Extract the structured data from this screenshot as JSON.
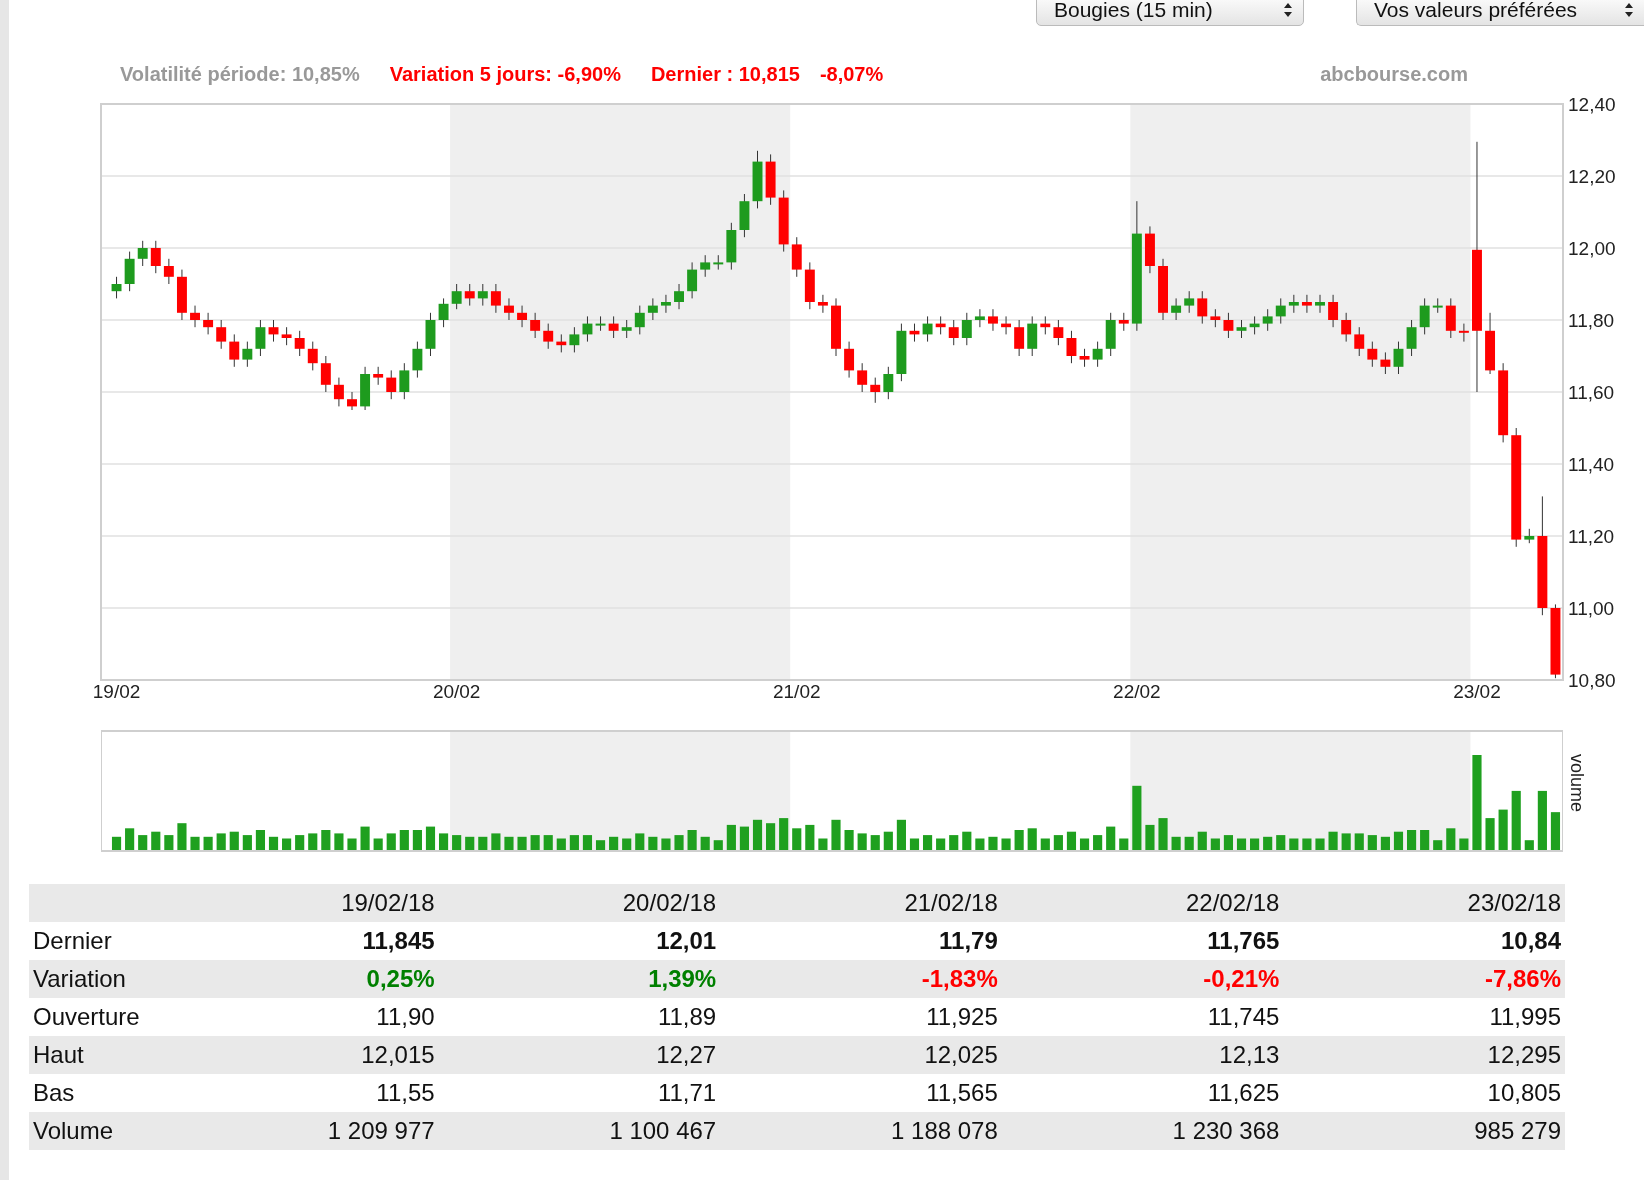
{
  "controls": [
    {
      "value": "Bougies (15 min)"
    },
    {
      "value": "Vos valeurs préférées"
    }
  ],
  "stats": [
    {
      "text": "Volatilité période: 10,85%",
      "color": "#999999"
    },
    {
      "text": "Variation 5 jours: -6,90%",
      "color": "#ff0000"
    },
    {
      "text": "Dernier : 10,815",
      "color": "#ff0000"
    },
    {
      "text": "-8,07%",
      "color": "#ff0000"
    }
  ],
  "source": "abcbourse.com",
  "chart": {
    "chart_data": {
      "type": "candlestick",
      "grid": true,
      "ylim": [
        10.8,
        12.4
      ],
      "yticks": [
        {
          "value": 12.4,
          "label": "12,40"
        },
        {
          "value": 12.2,
          "label": "12,20"
        },
        {
          "value": 12.0,
          "label": "12,00"
        },
        {
          "value": 11.8,
          "label": "11,80"
        },
        {
          "value": 11.6,
          "label": "11,60"
        },
        {
          "value": 11.4,
          "label": "11,40"
        },
        {
          "value": 11.2,
          "label": "11,20"
        },
        {
          "value": 11.0,
          "label": "11,00"
        },
        {
          "value": 10.8,
          "label": "10,80"
        }
      ],
      "categories": [
        "19/02",
        null,
        null,
        null,
        null,
        null,
        null,
        null,
        null,
        null,
        null,
        null,
        null,
        null,
        null,
        null,
        null,
        null,
        null,
        null,
        null,
        null,
        null,
        null,
        null,
        null,
        "20/02",
        null,
        null,
        null,
        null,
        null,
        null,
        null,
        null,
        null,
        null,
        null,
        null,
        null,
        null,
        null,
        null,
        null,
        null,
        null,
        null,
        null,
        null,
        null,
        null,
        null,
        "21/02",
        null,
        null,
        null,
        null,
        null,
        null,
        null,
        null,
        null,
        null,
        null,
        null,
        null,
        null,
        null,
        null,
        null,
        null,
        null,
        null,
        null,
        null,
        null,
        null,
        null,
        "22/02",
        null,
        null,
        null,
        null,
        null,
        null,
        null,
        null,
        null,
        null,
        null,
        null,
        null,
        null,
        null,
        null,
        null,
        null,
        null,
        null,
        null,
        null,
        null,
        null,
        null,
        "23/02",
        null,
        null,
        null,
        null,
        null,
        null
      ],
      "ohlc": [
        [
          11.88,
          11.92,
          11.86,
          11.9
        ],
        [
          11.9,
          11.99,
          11.88,
          11.97
        ],
        [
          11.97,
          12.02,
          11.95,
          12.0
        ],
        [
          12.0,
          12.02,
          11.93,
          11.95
        ],
        [
          11.95,
          11.97,
          11.9,
          11.92
        ],
        [
          11.92,
          11.94,
          11.8,
          11.82
        ],
        [
          11.82,
          11.84,
          11.78,
          11.8
        ],
        [
          11.8,
          11.82,
          11.76,
          11.78
        ],
        [
          11.78,
          11.8,
          11.72,
          11.74
        ],
        [
          11.74,
          11.76,
          11.67,
          11.69
        ],
        [
          11.69,
          11.74,
          11.67,
          11.72
        ],
        [
          11.72,
          11.8,
          11.7,
          11.78
        ],
        [
          11.78,
          11.8,
          11.74,
          11.76
        ],
        [
          11.76,
          11.78,
          11.73,
          11.75
        ],
        [
          11.75,
          11.77,
          11.7,
          11.72
        ],
        [
          11.72,
          11.74,
          11.66,
          11.68
        ],
        [
          11.68,
          11.7,
          11.6,
          11.62
        ],
        [
          11.62,
          11.64,
          11.56,
          11.58
        ],
        [
          11.58,
          11.6,
          11.55,
          11.56
        ],
        [
          11.56,
          11.67,
          11.55,
          11.65
        ],
        [
          11.65,
          11.67,
          11.62,
          11.64
        ],
        [
          11.64,
          11.66,
          11.58,
          11.6
        ],
        [
          11.6,
          11.68,
          11.58,
          11.66
        ],
        [
          11.66,
          11.74,
          11.64,
          11.72
        ],
        [
          11.72,
          11.82,
          11.7,
          11.8
        ],
        [
          11.8,
          11.86,
          11.78,
          11.845
        ],
        [
          11.845,
          11.9,
          11.83,
          11.88
        ],
        [
          11.88,
          11.9,
          11.84,
          11.86
        ],
        [
          11.86,
          11.9,
          11.84,
          11.88
        ],
        [
          11.88,
          11.9,
          11.82,
          11.84
        ],
        [
          11.84,
          11.86,
          11.8,
          11.82
        ],
        [
          11.82,
          11.84,
          11.78,
          11.8
        ],
        [
          11.8,
          11.82,
          11.75,
          11.77
        ],
        [
          11.77,
          11.79,
          11.72,
          11.74
        ],
        [
          11.74,
          11.76,
          11.71,
          11.73
        ],
        [
          11.73,
          11.78,
          11.71,
          11.76
        ],
        [
          11.76,
          11.81,
          11.74,
          11.79
        ],
        [
          11.79,
          11.81,
          11.77,
          11.79
        ],
        [
          11.79,
          11.81,
          11.75,
          11.77
        ],
        [
          11.77,
          11.8,
          11.75,
          11.78
        ],
        [
          11.78,
          11.84,
          11.76,
          11.82
        ],
        [
          11.82,
          11.86,
          11.8,
          11.84
        ],
        [
          11.84,
          11.87,
          11.82,
          11.85
        ],
        [
          11.85,
          11.9,
          11.83,
          11.88
        ],
        [
          11.88,
          11.96,
          11.86,
          11.94
        ],
        [
          11.94,
          11.98,
          11.92,
          11.96
        ],
        [
          11.96,
          11.98,
          11.94,
          11.96
        ],
        [
          11.96,
          12.07,
          11.94,
          12.05
        ],
        [
          12.05,
          12.15,
          12.03,
          12.13
        ],
        [
          12.13,
          12.27,
          12.11,
          12.24
        ],
        [
          12.24,
          12.26,
          12.12,
          12.14
        ],
        [
          12.14,
          12.16,
          11.99,
          12.01
        ],
        [
          12.01,
          12.03,
          11.92,
          11.94
        ],
        [
          11.94,
          11.96,
          11.83,
          11.85
        ],
        [
          11.85,
          11.87,
          11.82,
          11.84
        ],
        [
          11.84,
          11.86,
          11.7,
          11.72
        ],
        [
          11.72,
          11.74,
          11.64,
          11.66
        ],
        [
          11.66,
          11.68,
          11.6,
          11.62
        ],
        [
          11.62,
          11.64,
          11.57,
          11.6
        ],
        [
          11.6,
          11.67,
          11.58,
          11.65
        ],
        [
          11.65,
          11.79,
          11.63,
          11.77
        ],
        [
          11.77,
          11.79,
          11.74,
          11.76
        ],
        [
          11.76,
          11.81,
          11.74,
          11.79
        ],
        [
          11.79,
          11.81,
          11.76,
          11.78
        ],
        [
          11.78,
          11.8,
          11.73,
          11.75
        ],
        [
          11.75,
          11.82,
          11.73,
          11.8
        ],
        [
          11.8,
          11.83,
          11.78,
          11.81
        ],
        [
          11.81,
          11.83,
          11.77,
          11.79
        ],
        [
          11.79,
          11.81,
          11.76,
          11.78
        ],
        [
          11.78,
          11.8,
          11.7,
          11.72
        ],
        [
          11.72,
          11.81,
          11.7,
          11.79
        ],
        [
          11.79,
          11.81,
          11.76,
          11.78
        ],
        [
          11.78,
          11.8,
          11.73,
          11.75
        ],
        [
          11.75,
          11.77,
          11.68,
          11.7
        ],
        [
          11.7,
          11.72,
          11.67,
          11.69
        ],
        [
          11.69,
          11.74,
          11.67,
          11.72
        ],
        [
          11.72,
          11.82,
          11.7,
          11.8
        ],
        [
          11.8,
          11.82,
          11.77,
          11.79
        ],
        [
          11.79,
          12.13,
          11.77,
          12.04
        ],
        [
          12.04,
          12.06,
          11.93,
          11.95
        ],
        [
          11.95,
          11.97,
          11.8,
          11.82
        ],
        [
          11.82,
          11.86,
          11.8,
          11.84
        ],
        [
          11.84,
          11.88,
          11.82,
          11.86
        ],
        [
          11.86,
          11.88,
          11.79,
          11.81
        ],
        [
          11.81,
          11.83,
          11.78,
          11.8
        ],
        [
          11.8,
          11.82,
          11.75,
          11.77
        ],
        [
          11.77,
          11.8,
          11.75,
          11.78
        ],
        [
          11.78,
          11.81,
          11.76,
          11.79
        ],
        [
          11.79,
          11.83,
          11.77,
          11.81
        ],
        [
          11.81,
          11.86,
          11.79,
          11.84
        ],
        [
          11.84,
          11.87,
          11.82,
          11.85
        ],
        [
          11.85,
          11.87,
          11.82,
          11.84
        ],
        [
          11.84,
          11.87,
          11.82,
          11.85
        ],
        [
          11.85,
          11.87,
          11.78,
          11.8
        ],
        [
          11.8,
          11.82,
          11.74,
          11.76
        ],
        [
          11.76,
          11.78,
          11.7,
          11.72
        ],
        [
          11.72,
          11.74,
          11.67,
          11.69
        ],
        [
          11.69,
          11.71,
          11.65,
          11.67
        ],
        [
          11.67,
          11.74,
          11.65,
          11.72
        ],
        [
          11.72,
          11.8,
          11.7,
          11.78
        ],
        [
          11.78,
          11.86,
          11.76,
          11.84
        ],
        [
          11.84,
          11.86,
          11.82,
          11.84
        ],
        [
          11.84,
          11.86,
          11.75,
          11.77
        ],
        [
          11.77,
          11.79,
          11.74,
          11.765
        ],
        [
          11.995,
          12.295,
          11.6,
          11.77
        ],
        [
          11.77,
          11.82,
          11.65,
          11.66
        ],
        [
          11.66,
          11.68,
          11.46,
          11.48
        ],
        [
          11.48,
          11.5,
          11.17,
          11.19
        ],
        [
          11.19,
          11.22,
          11.18,
          11.2
        ],
        [
          11.2,
          11.31,
          10.98,
          11.0
        ],
        [
          11.0,
          11.01,
          10.805,
          10.815
        ]
      ]
    }
  },
  "volume_label": "volume",
  "table": {
    "columns": [
      "19/02/18",
      "20/02/18",
      "21/02/18",
      "22/02/18",
      "23/02/18"
    ],
    "rows": [
      {
        "label": "Dernier",
        "bold": true,
        "cells": [
          {
            "value": "11,845"
          },
          {
            "value": "12,01"
          },
          {
            "value": "11,79"
          },
          {
            "value": "11,765"
          },
          {
            "value": "10,84"
          }
        ]
      },
      {
        "label": "Variation",
        "bold": true,
        "cells": [
          {
            "value": "0,25%",
            "color": "#008000"
          },
          {
            "value": "1,39%",
            "color": "#008000"
          },
          {
            "value": "-1,83%",
            "color": "#ff0000"
          },
          {
            "value": "-0,21%",
            "color": "#ff0000"
          },
          {
            "value": "-7,86%",
            "color": "#ff0000"
          }
        ]
      },
      {
        "label": "Ouverture",
        "bold": false,
        "cells": [
          {
            "value": "11,90"
          },
          {
            "value": "11,89"
          },
          {
            "value": "11,925"
          },
          {
            "value": "11,745"
          },
          {
            "value": "11,995"
          }
        ]
      },
      {
        "label": "Haut",
        "bold": false,
        "cells": [
          {
            "value": "12,015"
          },
          {
            "value": "12,27"
          },
          {
            "value": "12,025"
          },
          {
            "value": "12,13"
          },
          {
            "value": "12,295"
          }
        ]
      },
      {
        "label": "Bas",
        "bold": false,
        "cells": [
          {
            "value": "11,55"
          },
          {
            "value": "11,71"
          },
          {
            "value": "11,565"
          },
          {
            "value": "11,625"
          },
          {
            "value": "10,805"
          }
        ]
      },
      {
        "label": "Volume",
        "bold": false,
        "cells": [
          {
            "value": "1 209 977"
          },
          {
            "value": "1 100 467"
          },
          {
            "value": "1 188 078"
          },
          {
            "value": "1 230 368"
          },
          {
            "value": "985 279"
          }
        ]
      }
    ]
  }
}
